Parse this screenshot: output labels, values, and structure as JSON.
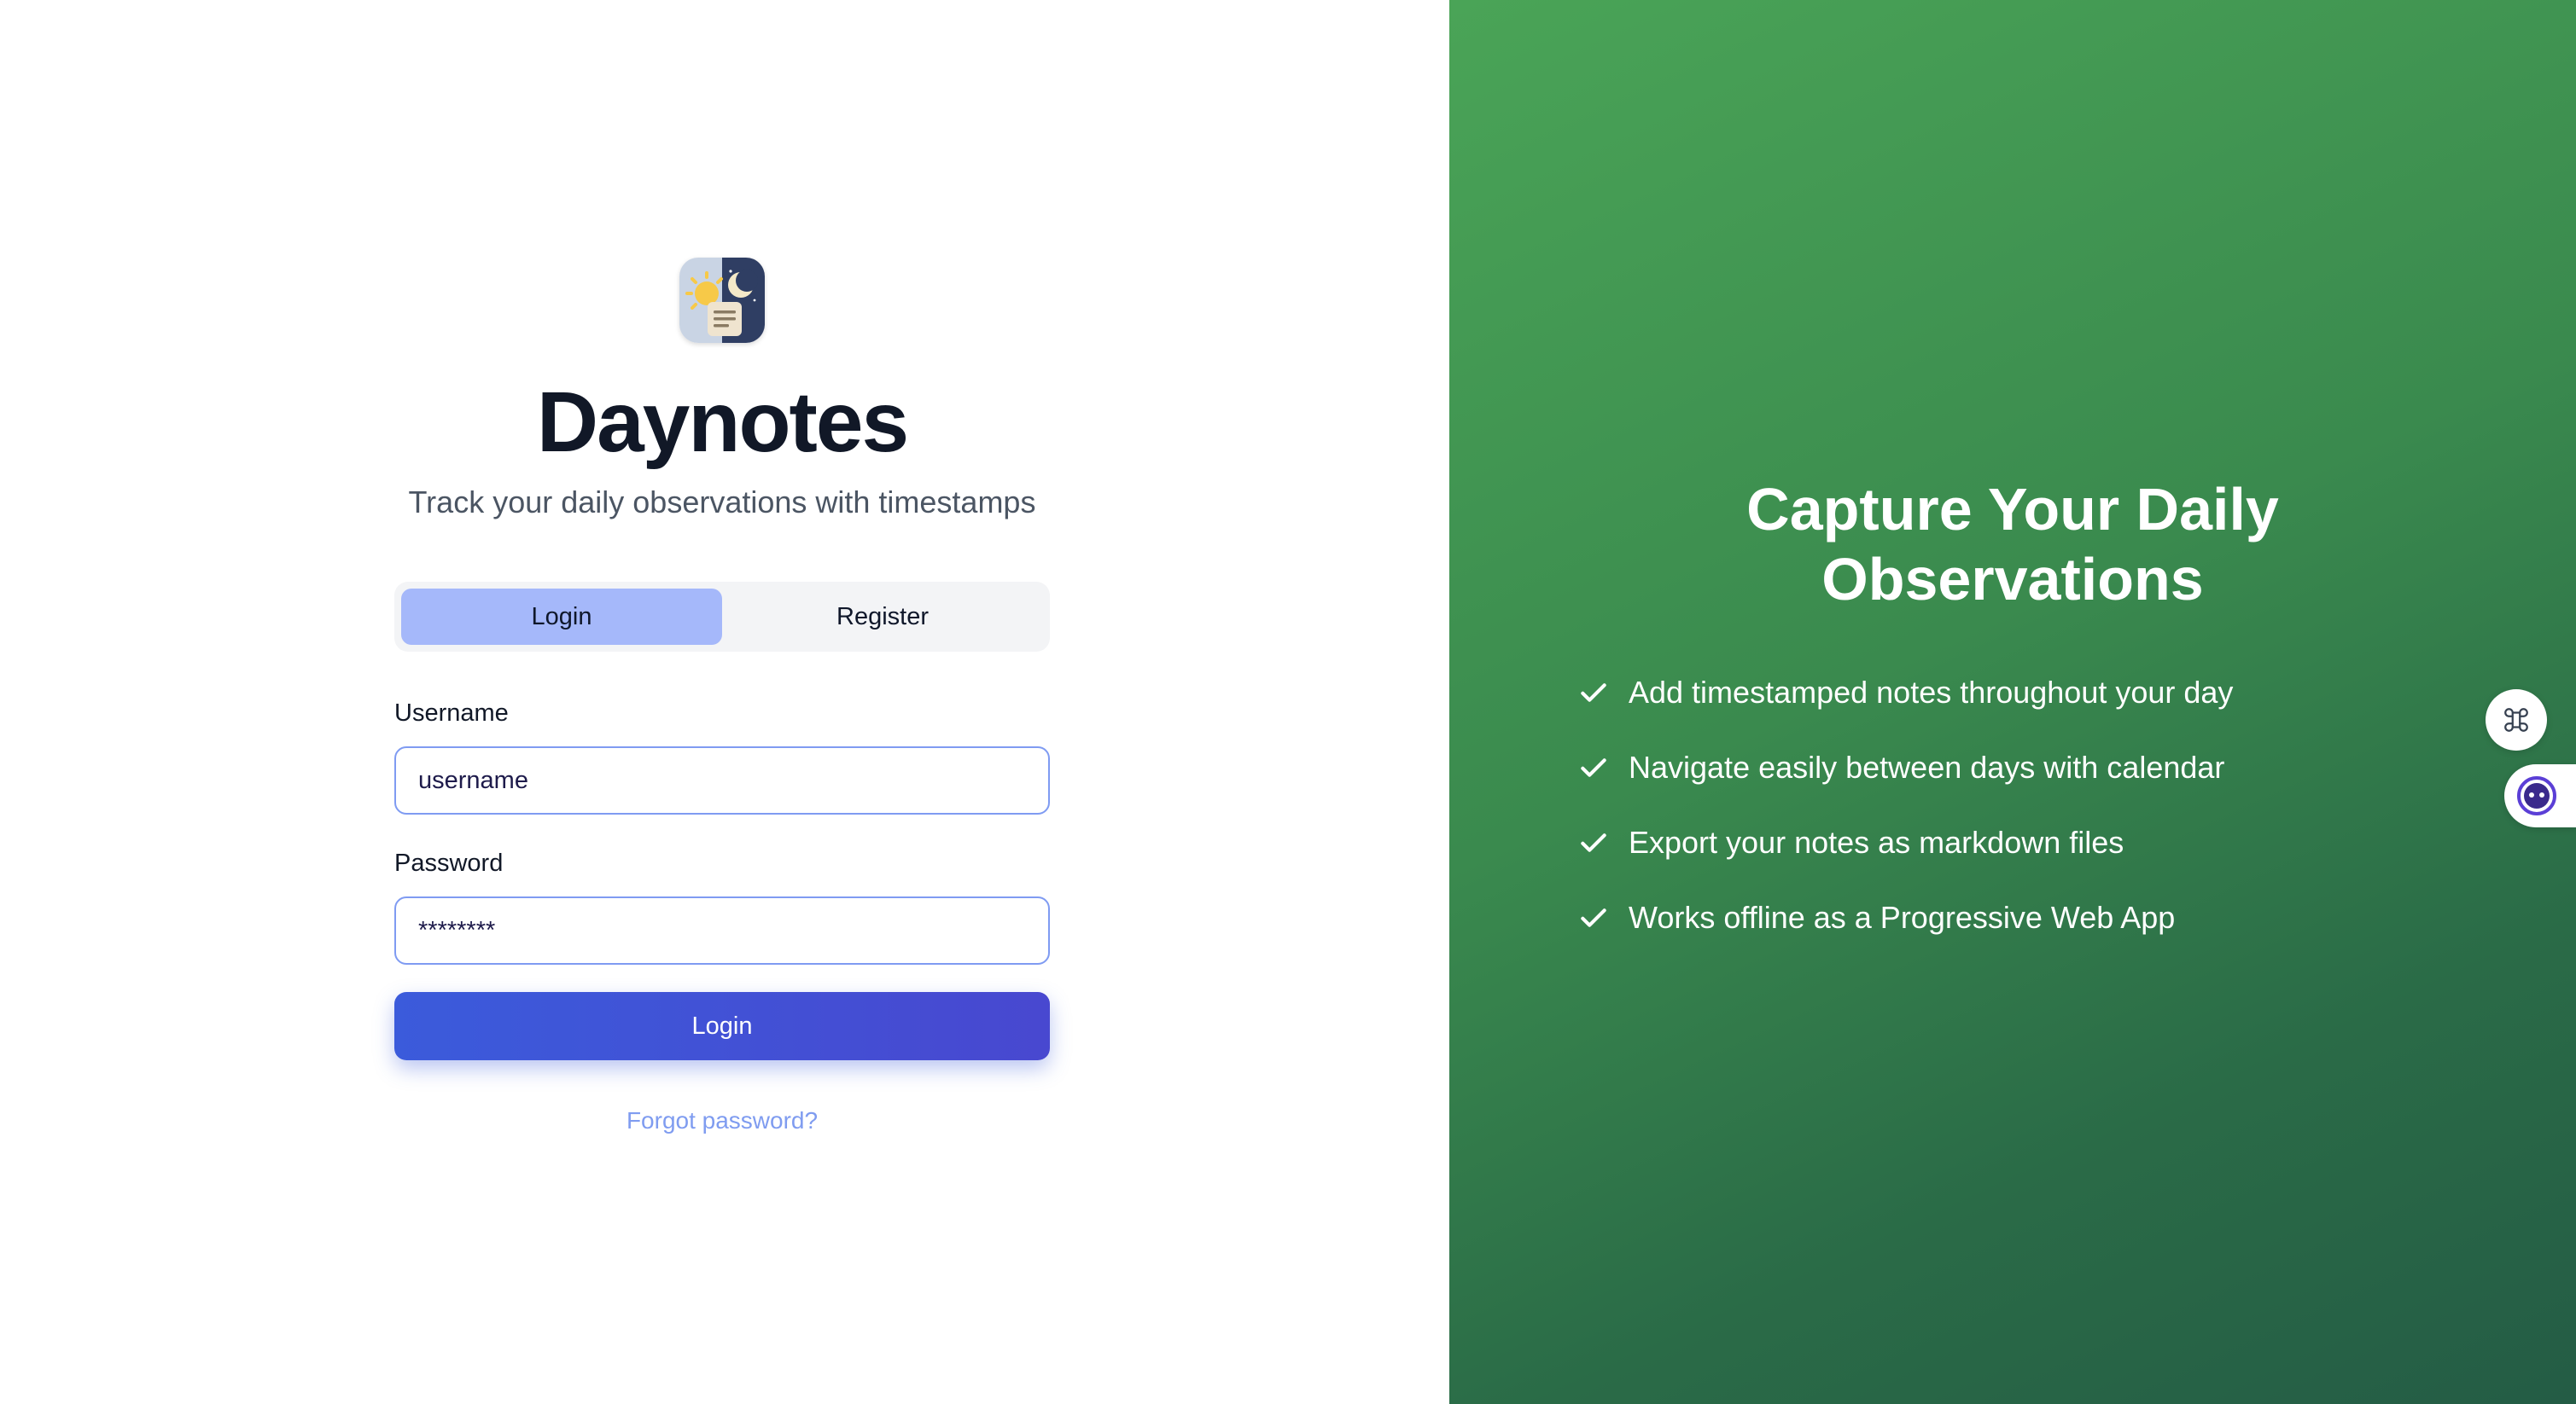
{
  "app": {
    "title": "Daynotes",
    "subtitle": "Track your daily observations with timestamps",
    "logo_icon": "sun-moon-notes-icon"
  },
  "auth_tabs": [
    {
      "label": "Login",
      "active": true
    },
    {
      "label": "Register",
      "active": false
    }
  ],
  "form": {
    "username_label": "Username",
    "username_value": "username",
    "password_label": "Password",
    "password_value": "********",
    "submit_label": "Login",
    "forgot_label": "Forgot password?"
  },
  "hero": {
    "title_line1": "Capture Your Daily",
    "title_line2": "Observations",
    "features": [
      "Add timestamped notes throughout your day",
      "Navigate easily between days with calendar",
      "Export your notes as markdown files",
      "Works offline as a Progressive Web App"
    ],
    "check_icon": "checkmark-icon"
  },
  "floating": {
    "shortcuts_icon": "command-icon",
    "assistant_icon": "assistant-face-icon"
  },
  "colors": {
    "primary": "#3b5bdb",
    "tab_active": "#a5b8fa",
    "hero_green_start": "#4aa457",
    "hero_green_end": "#245c45",
    "title_text": "#111827"
  }
}
